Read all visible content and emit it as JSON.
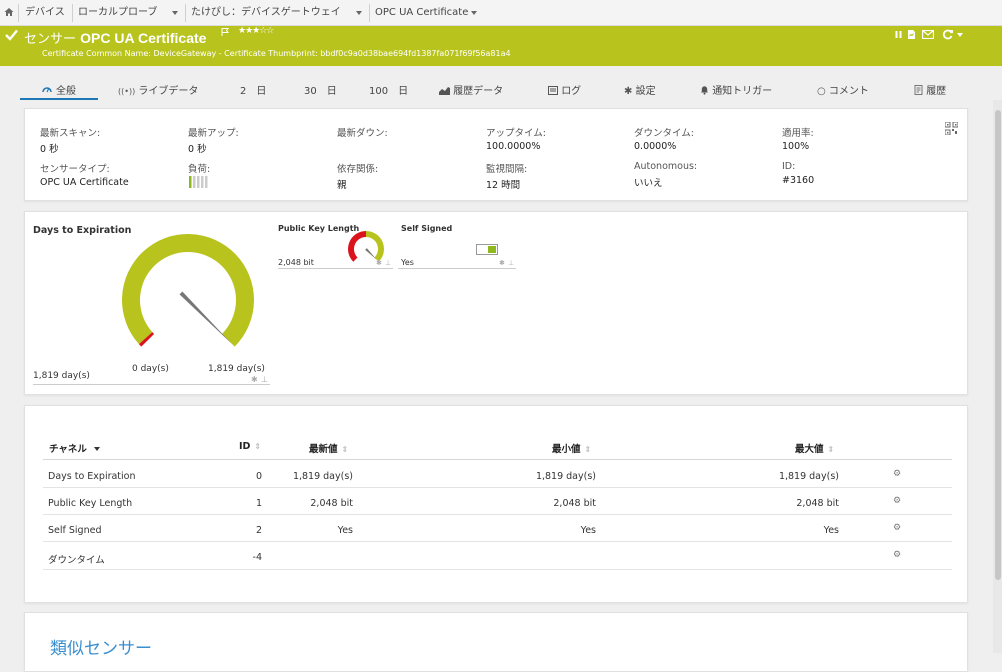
{
  "breadcrumb": {
    "items": [
      "デバイス",
      "ローカルプローブ",
      "たけぴし：デバイスゲートウェイ",
      "OPC UA Certificate"
    ]
  },
  "header": {
    "prefix": "センサー",
    "title": "OPC UA Certificate",
    "stars": "★★★☆☆",
    "subtitle": "Certificate Common Name: DeviceGateway - Certificate Thumbprint: bbdf0c9a0d38bae694fd1387fa071f69f56a81a4"
  },
  "tabs": [
    {
      "label": "全般",
      "icon": "gauge-icon"
    },
    {
      "label": "ライブデータ",
      "icon": "live-icon"
    },
    {
      "label": "2　日",
      "icon": ""
    },
    {
      "label": "30　日",
      "icon": ""
    },
    {
      "label": "100　日",
      "icon": ""
    },
    {
      "label": "履歴データ",
      "icon": "area-chart-icon"
    },
    {
      "label": "ログ",
      "icon": "log-icon"
    },
    {
      "label": "設定",
      "icon": "gear-icon"
    },
    {
      "label": "通知トリガー",
      "icon": "bell-icon"
    },
    {
      "label": "コメント",
      "icon": "comment-icon"
    },
    {
      "label": "履歴",
      "icon": "history-icon"
    }
  ],
  "status": {
    "last_scan_label": "最新スキャン:",
    "last_scan": "0 秒",
    "last_up_label": "最新アップ:",
    "last_up": "0 秒",
    "last_down_label": "最新ダウン:",
    "last_down": "",
    "uptime_label": "アップタイム:",
    "uptime": "100.0000%",
    "downtime_label": "ダウンタイム:",
    "downtime": "0.0000%",
    "coverage_label": "適用率:",
    "coverage": "100%",
    "sensor_type_label": "センサータイプ:",
    "sensor_type": "OPC UA Certificate",
    "load_label": "負荷:",
    "dependency_label": "依存関係:",
    "dependency": "親",
    "interval_label": "監視間隔:",
    "interval": "12 時間",
    "autonomous_label": "Autonomous:",
    "autonomous": "いいえ",
    "id_label": "ID:",
    "id": "#3160"
  },
  "gauges": {
    "days": {
      "title": "Days to Expiration",
      "value": "1,819 day(s)",
      "min_label": "0 day(s)",
      "max_label": "1,819 day(s)",
      "fraction": 1.0
    },
    "pubkey": {
      "title": "Public Key Length",
      "value": "2,048 bit",
      "fraction": 0.5
    },
    "selfsigned": {
      "title": "Self Signed",
      "value": "Yes"
    }
  },
  "table": {
    "headers": {
      "channel": "チャネル",
      "id": "ID",
      "last": "最新値",
      "min": "最小値",
      "max": "最大値"
    },
    "rows": [
      {
        "channel": "Days to Expiration",
        "id": "0",
        "last": "1,819 day(s)",
        "min": "1,819 day(s)",
        "max": "1,819 day(s)"
      },
      {
        "channel": "Public Key Length",
        "id": "1",
        "last": "2,048 bit",
        "min": "2,048 bit",
        "max": "2,048 bit"
      },
      {
        "channel": "Self Signed",
        "id": "2",
        "last": "Yes",
        "min": "Yes",
        "max": "Yes"
      },
      {
        "channel": "ダウンタイム",
        "id": "-4",
        "last": "",
        "min": "",
        "max": ""
      }
    ]
  },
  "similar": {
    "title": "類似センサー"
  },
  "colors": {
    "brand_green": "#b8c41d",
    "accent_blue": "#1e77b5",
    "gauge_red": "#d9141c"
  }
}
